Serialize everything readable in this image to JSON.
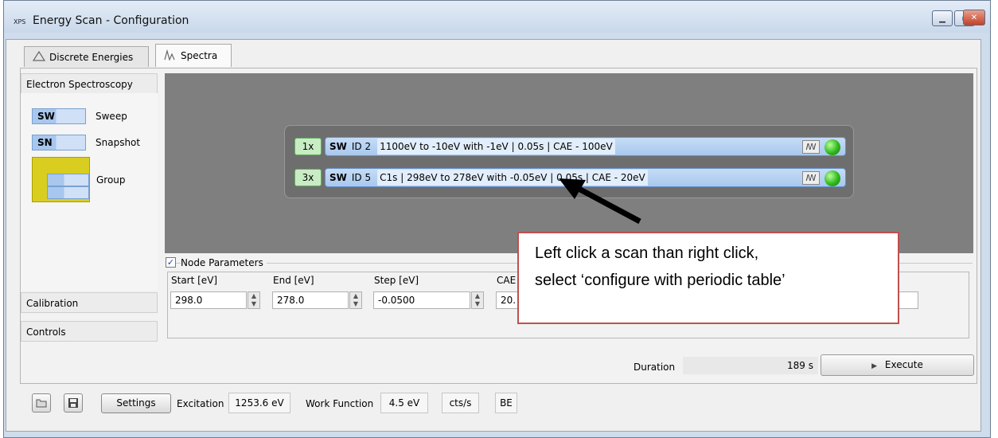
{
  "window": {
    "app_icon_text": "XPS",
    "title": "Energy Scan - Configuration",
    "controls": [
      "minimize",
      "maximize",
      "close"
    ]
  },
  "tabs": [
    {
      "label": "Discrete Energies",
      "icon": "discrete-energies-icon",
      "active": false
    },
    {
      "label": "Spectra",
      "icon": "spectra-icon",
      "active": true
    }
  ],
  "sidebar": {
    "top": "Electron Spectroscopy",
    "palette": [
      {
        "chip": "SW",
        "label": "Sweep"
      },
      {
        "chip": "SN",
        "label": "Snapshot"
      },
      {
        "chip": "",
        "label": "Group"
      }
    ],
    "bottom": [
      "Calibration",
      "Controls"
    ]
  },
  "scans": [
    {
      "repeat": "1x",
      "type": "SW",
      "id": "ID 2",
      "desc": "1100eV to -10eV with -1eV | 0.05s | CAE - 100eV",
      "status_color": "#2fb81b"
    },
    {
      "repeat": "3x",
      "type": "SW",
      "id": "ID 5",
      "desc": "C1s | 298eV to 278eV with -0.05eV | 0.05s | CAE - 20eV",
      "status_color": "#2fb81b"
    }
  ],
  "node_params": {
    "enabled": true,
    "title": "Node Parameters",
    "fields": [
      {
        "label": "Start [eV]",
        "value": "298.0"
      },
      {
        "label": "End [eV]",
        "value": "278.0"
      },
      {
        "label": "Step [eV]",
        "value": "-0.0500"
      },
      {
        "label": "CAE",
        "value": "20."
      }
    ]
  },
  "duration": {
    "label": "Duration",
    "value": "189 s"
  },
  "execute_label": "Execute",
  "bottom_bar": {
    "settings_label": "Settings",
    "excitation_label": "Excitation",
    "excitation_value": "1253.6 eV",
    "work_function_label": "Work Function",
    "work_function_value": "4.5 eV",
    "unit": "cts/s",
    "energy_mode": "BE"
  },
  "callout": {
    "line1": "Left click a scan than right click,",
    "line2": "select ‘configure with periodic table’",
    "border_color": "#c0504d"
  }
}
